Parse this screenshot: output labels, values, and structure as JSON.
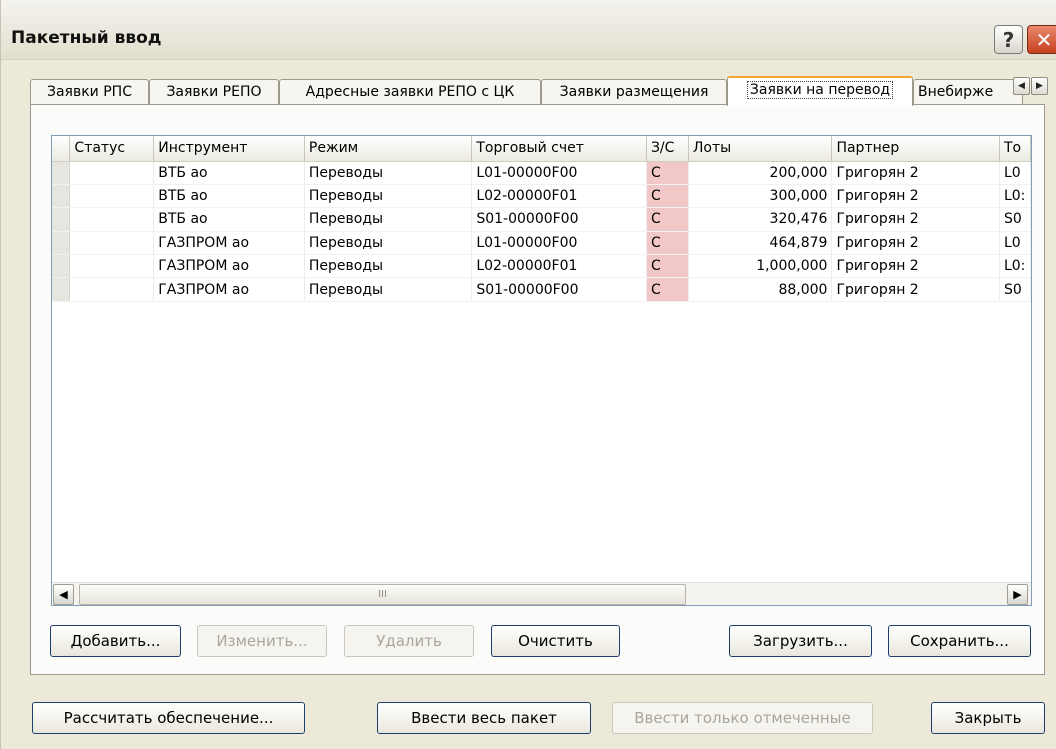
{
  "window": {
    "title": "Пакетный ввод",
    "help_glyph": "?",
    "close_glyph": "✕"
  },
  "tabs": [
    {
      "label": "Заявки РПС",
      "active": false
    },
    {
      "label": "Заявки РЕПО",
      "active": false
    },
    {
      "label": "Адресные заявки РЕПО с ЦК",
      "active": false
    },
    {
      "label": "Заявки размещения",
      "active": false
    },
    {
      "label": "Заявки на перевод",
      "active": true
    },
    {
      "label": "Внебирже",
      "active": false
    }
  ],
  "tab_scroll": {
    "left_glyph": "◀",
    "right_glyph": "▶"
  },
  "table": {
    "columns": [
      "Статус",
      "Инструмент",
      "Режим",
      "Торговый счет",
      "З/С",
      "Лоты",
      "Партнер",
      "То"
    ],
    "rows": [
      {
        "status": "",
        "instrument": "ВТБ ао",
        "mode": "Переводы",
        "account": "L01-00000F00",
        "side": "С",
        "lots": "200,000",
        "partner": "Григорян 2",
        "to": "L0"
      },
      {
        "status": "",
        "instrument": "ВТБ ао",
        "mode": "Переводы",
        "account": "L02-00000F01",
        "side": "С",
        "lots": "300,000",
        "partner": "Григорян 2",
        "to": "L0:"
      },
      {
        "status": "",
        "instrument": "ВТБ ао",
        "mode": "Переводы",
        "account": "S01-00000F00",
        "side": "С",
        "lots": "320,476",
        "partner": "Григорян 2",
        "to": "S0"
      },
      {
        "status": "",
        "instrument": "ГАЗПРОМ ао",
        "mode": "Переводы",
        "account": "L01-00000F00",
        "side": "С",
        "lots": "464,879",
        "partner": "Григорян 2",
        "to": "L0"
      },
      {
        "status": "",
        "instrument": "ГАЗПРОМ ао",
        "mode": "Переводы",
        "account": "L02-00000F01",
        "side": "С",
        "lots": "1,000,000",
        "partner": "Григорян 2",
        "to": "L0:"
      },
      {
        "status": "",
        "instrument": "ГАЗПРОМ ао",
        "mode": "Переводы",
        "account": "S01-00000F00",
        "side": "С",
        "lots": "88,000",
        "partner": "Григорян 2",
        "to": "S0"
      }
    ],
    "sell_highlight_color": "#f2c7c7"
  },
  "hscroll": {
    "left_glyph": "◀",
    "right_glyph": "▶",
    "thumb_grip": "III"
  },
  "panel_buttons": {
    "add": "Добавить...",
    "edit": "Изменить...",
    "delete": "Удалить",
    "clear": "Очистить",
    "load": "Загрузить...",
    "save": "Сохранить..."
  },
  "bottom_buttons": {
    "calc": "Рассчитать обеспечение...",
    "enter_all": "Ввести весь пакет",
    "enter_marked": "Ввести только отмеченные",
    "close": "Закрыть"
  }
}
